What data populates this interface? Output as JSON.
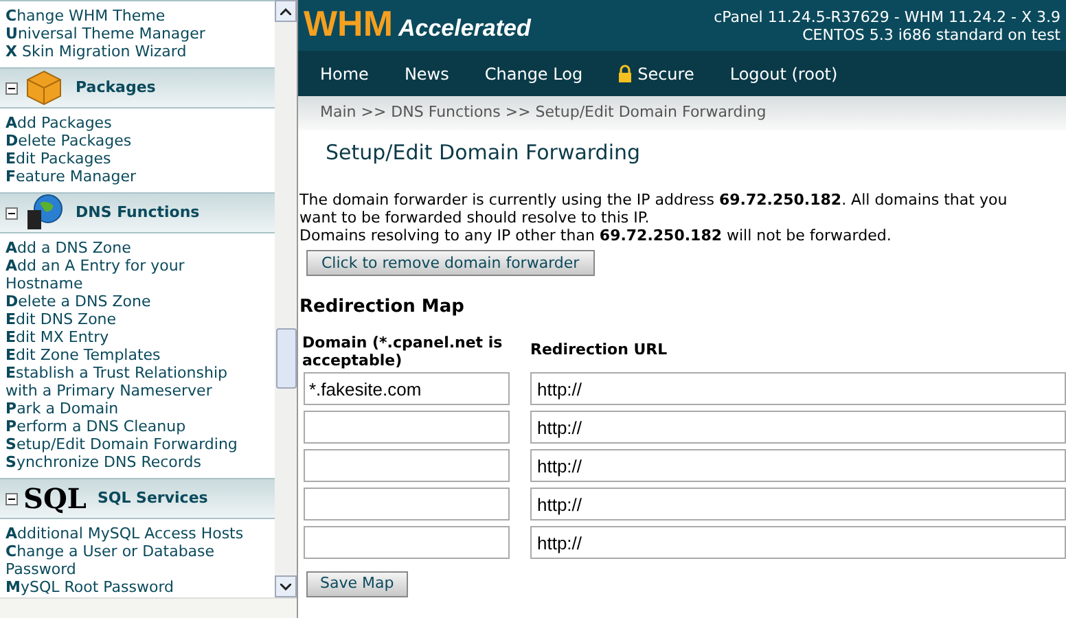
{
  "sidebar": {
    "sections": [
      {
        "items": [
          "**C**hange WHM Theme",
          "**U**niversal Theme Manager",
          "**X** Skin Migration Wizard"
        ]
      },
      {
        "title": "Packages",
        "kind": "box",
        "expanded": true,
        "items": [
          "**A**dd Packages",
          "**D**elete Packages",
          "**E**dit Packages",
          "**F**eature Manager"
        ]
      },
      {
        "title": "DNS Functions",
        "kind": "globe",
        "expanded": true,
        "items": [
          "**A**dd a DNS Zone",
          "**A**dd an A Entry for your Hostname",
          "**D**elete a DNS Zone",
          "**E**dit DNS Zone",
          "**E**dit MX Entry",
          "**E**dit Zone Templates",
          "**E**stablish a Trust Relationship with a Primary Nameserver",
          "**P**ark a Domain",
          "**P**erform a DNS Cleanup",
          "**S**etup/Edit Domain Forwarding",
          "**S**ynchronize DNS Records"
        ]
      },
      {
        "title": "SQL Services",
        "kind": "sql",
        "logo_text": "SQL",
        "expanded": true,
        "items": [
          "**A**dditional MySQL Access Hosts",
          "**C**hange a User or Database Password",
          "**M**ySQL Root Password"
        ]
      }
    ]
  },
  "header": {
    "logo_main": "WHM",
    "logo_sub": "Accelerated",
    "version": "cPanel 11.24.5-R37629 - WHM 11.24.2 - X 3.9",
    "system": "CENTOS 5.3 i686 standard on test"
  },
  "nav": [
    {
      "label": "Home",
      "kind": "link"
    },
    {
      "label": "News",
      "kind": "link"
    },
    {
      "label": "Change Log",
      "kind": "link"
    },
    {
      "label": "Secure",
      "kind": "lock"
    },
    {
      "label": "Logout (root)",
      "kind": "link"
    }
  ],
  "breadcrumb": "Main >> DNS Functions >> Setup/Edit Domain Forwarding",
  "page_title": "Setup/Edit Domain Forwarding",
  "info": [
    "The domain forwarder is currently using the IP address **69.72.250.182**. All domains that you want to be forwarded should resolve to this IP.",
    "Domains resolving to any IP other than **69.72.250.182** will not be forwarded."
  ],
  "remove_button": "Click to remove domain forwarder",
  "map": {
    "title": "Redirection Map",
    "columns": [
      "Domain (*.cpanel.net is acceptable)",
      "Redirection URL"
    ],
    "rows": [
      {
        "domain": "*.fakesite.com",
        "url": "http://"
      },
      {
        "domain": "",
        "url": "http://"
      },
      {
        "domain": "",
        "url": "http://"
      },
      {
        "domain": "",
        "url": "http://"
      },
      {
        "domain": "",
        "url": "http://"
      }
    ]
  },
  "save_button": "Save Map"
}
